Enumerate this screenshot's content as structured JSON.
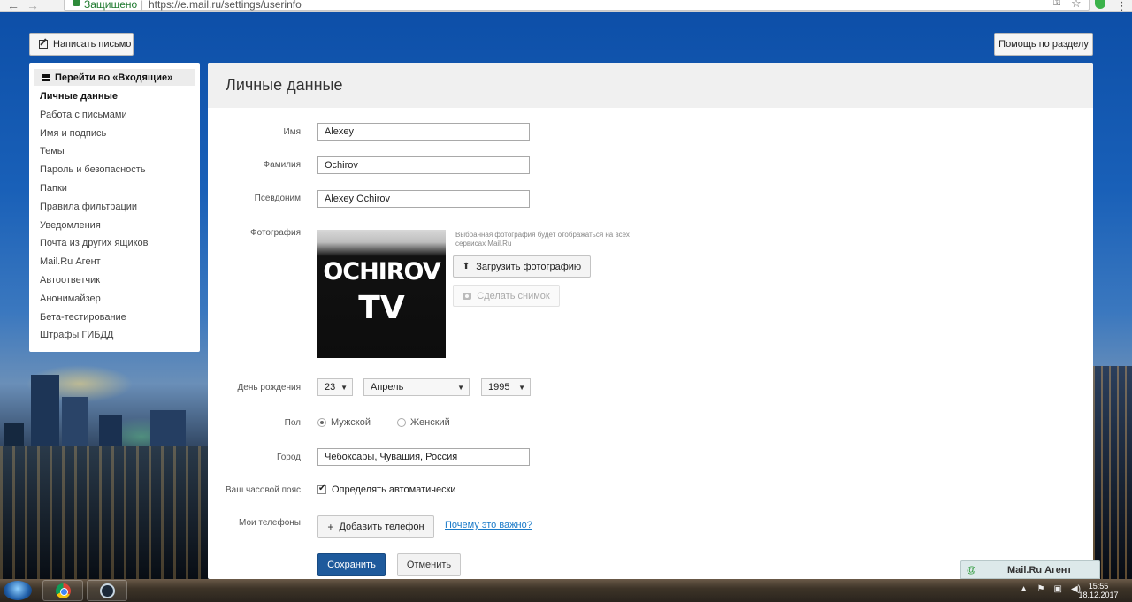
{
  "browser": {
    "secure_label": "Защищено",
    "url_separator": "|",
    "url": "https://e.mail.ru/settings/userinfo"
  },
  "toolbar": {
    "compose_label": "Написать письмо",
    "help_label": "Помощь по разделу"
  },
  "sidebar": {
    "inbox_label": "Перейти во «Входящие»",
    "items": [
      {
        "label": "Личные данные",
        "active": true
      },
      {
        "label": "Работа с письмами"
      },
      {
        "label": "Имя и подпись"
      },
      {
        "label": "Темы"
      },
      {
        "label": "Пароль и безопасность"
      },
      {
        "label": "Папки"
      },
      {
        "label": "Правила фильтрации"
      },
      {
        "label": "Уведомления"
      },
      {
        "label": "Почта из других ящиков"
      },
      {
        "label": "Mail.Ru Агент"
      },
      {
        "label": "Автоответчик"
      },
      {
        "label": "Анонимайзер"
      },
      {
        "label": "Бета-тестирование"
      },
      {
        "label": "Штрафы ГИБДД"
      }
    ]
  },
  "page": {
    "title": "Личные данные"
  },
  "form": {
    "first_name": {
      "label": "Имя",
      "value": "Alexey"
    },
    "last_name": {
      "label": "Фамилия",
      "value": "Ochirov"
    },
    "nickname": {
      "label": "Псевдоним",
      "value": "Alexey Ochirov"
    },
    "photo": {
      "label": "Фотография",
      "image_text_line1": "OCHIROV",
      "image_text_line2": "TV",
      "hint": "Выбранная фотография будет отображаться на всех сервисах Mail.Ru",
      "upload_label": "Загрузить фотографию",
      "snapshot_label": "Сделать снимок"
    },
    "birthday": {
      "label": "День рождения",
      "day": "23",
      "month": "Апрель",
      "year": "1995"
    },
    "gender": {
      "label": "Пол",
      "male": "Мужской",
      "female": "Женский",
      "selected": "male"
    },
    "city": {
      "label": "Город",
      "value": "Чебоксары, Чувашия, Россия"
    },
    "timezone": {
      "label": "Ваш часовой пояс",
      "auto_label": "Определять автоматически",
      "checked": true
    },
    "phones": {
      "label": "Мои телефоны",
      "add_label": "Добавить телефон",
      "why_link": "Почему это важно?"
    },
    "save_label": "Сохранить",
    "cancel_label": "Отменить"
  },
  "agent": {
    "label": "Mail.Ru Агент"
  },
  "taskbar": {
    "time": "15:55",
    "date": "18.12.2017"
  },
  "colors": {
    "primary_button": "#1e5a9c",
    "link": "#1a7ac8",
    "header_bg": "#f0f0f0",
    "page_bg": "#0d4fa8"
  }
}
